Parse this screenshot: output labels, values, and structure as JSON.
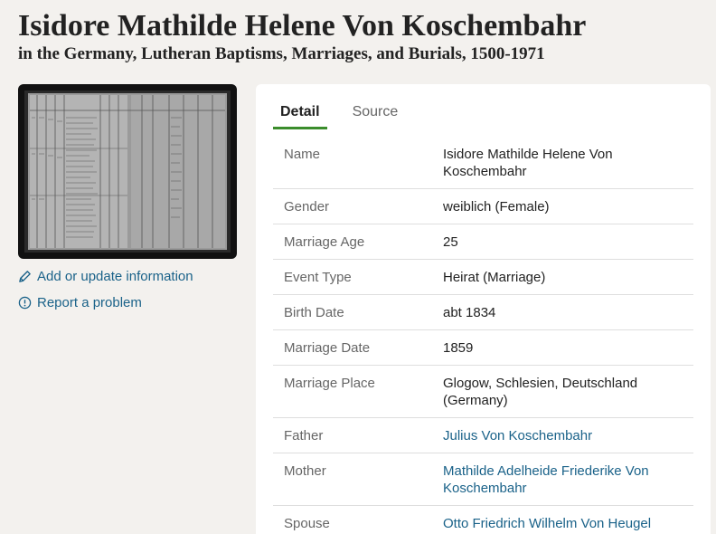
{
  "header": {
    "title": "Isidore Mathilde Helene Von Koschembahr",
    "subtitle": "in the Germany, Lutheran Baptisms, Marriages, and Burials, 1500-1971"
  },
  "sidebar": {
    "add_label": "Add or update information",
    "report_label": "Report a problem"
  },
  "tabs": [
    {
      "label": "Detail",
      "active": true
    },
    {
      "label": "Source",
      "active": false
    }
  ],
  "details": [
    {
      "label": "Name",
      "value": "Isidore Mathilde Helene Von Koschembahr",
      "link": false
    },
    {
      "label": "Gender",
      "value": "weiblich (Female)",
      "link": false
    },
    {
      "label": "Marriage Age",
      "value": "25",
      "link": false
    },
    {
      "label": "Event Type",
      "value": "Heirat (Marriage)",
      "link": false
    },
    {
      "label": "Birth Date",
      "value": "abt 1834",
      "link": false
    },
    {
      "label": "Marriage Date",
      "value": "1859",
      "link": false
    },
    {
      "label": "Marriage Place",
      "value": "Glogow, Schlesien, Deutschland (Germany)",
      "link": false
    },
    {
      "label": "Father",
      "value": "Julius Von Koschembahr",
      "link": true
    },
    {
      "label": "Mother",
      "value": "Mathilde Adelheide Friederike Von Koschembahr",
      "link": true
    },
    {
      "label": "Spouse",
      "value": "Otto Friedrich Wilhelm Von Heugel",
      "link": true
    }
  ],
  "colors": {
    "link": "#1a6289",
    "tab_accent": "#3b8d2c",
    "background": "#f3f1ee"
  }
}
